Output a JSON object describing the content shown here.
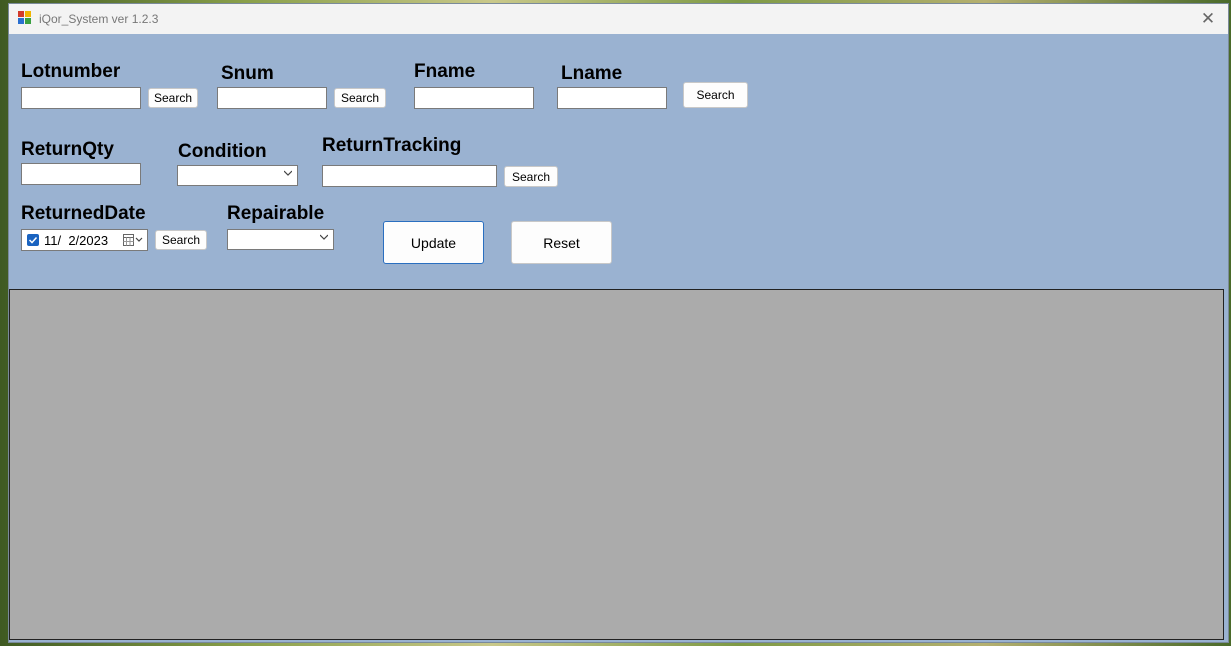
{
  "window": {
    "title": "iQor_System ver 1.2.3",
    "close_glyph": "✕"
  },
  "fields": {
    "lotnumber": {
      "label": "Lotnumber",
      "value": "",
      "search_label": "Search"
    },
    "snum": {
      "label": "Snum",
      "value": "",
      "search_label": "Search"
    },
    "fname": {
      "label": "Fname",
      "value": ""
    },
    "lname": {
      "label": "Lname",
      "value": "",
      "search_label": "Search"
    },
    "returnqty": {
      "label": "ReturnQty",
      "value": ""
    },
    "condition": {
      "label": "Condition",
      "selected": ""
    },
    "returntracking": {
      "label": "ReturnTracking",
      "value": "",
      "search_label": "Search"
    },
    "returneddate": {
      "label": "ReturnedDate",
      "value": "11/  2/2023",
      "checked": true,
      "search_label": "Search"
    },
    "repairable": {
      "label": "Repairable",
      "selected": ""
    }
  },
  "actions": {
    "update_label": "Update",
    "reset_label": "Reset"
  },
  "colors": {
    "form_bg": "#9ab2d1",
    "grid_bg": "#ababab",
    "accent": "#1a63c0"
  }
}
